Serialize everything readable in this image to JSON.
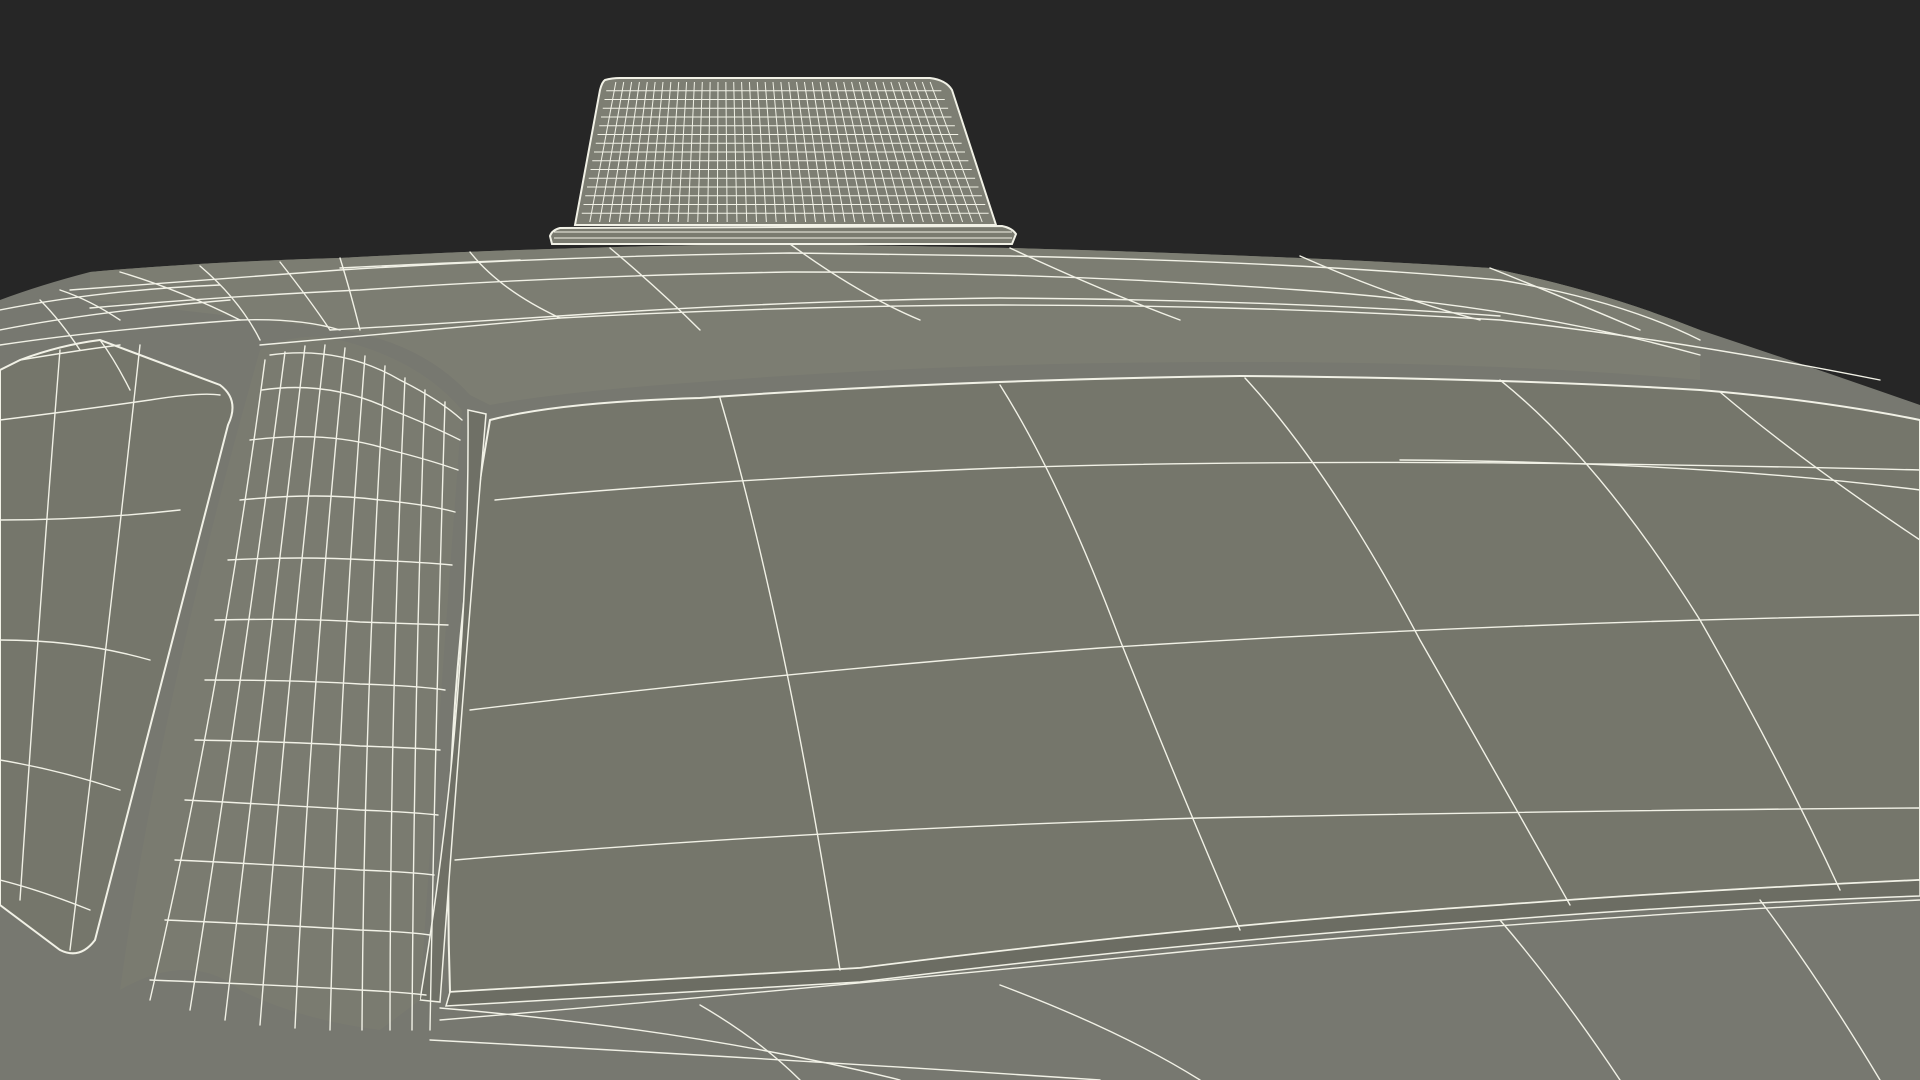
{
  "scene": {
    "subject_icon": "taxi-wireframe-icon",
    "colors": {
      "background": "#262626",
      "surface": "#7a7b6f",
      "surface_dark": "#6d6e63",
      "surface_light": "#828377",
      "wire": "#f1f1e6",
      "shadow": "#4a4b44"
    }
  }
}
